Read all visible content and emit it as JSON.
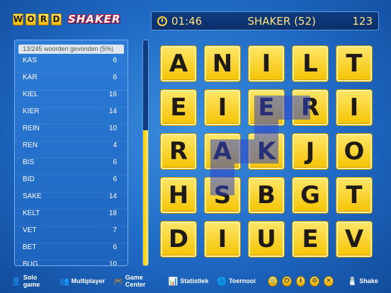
{
  "logo": {
    "tiles": [
      "W",
      "O",
      "R",
      "D"
    ],
    "shaker": "SHAKER"
  },
  "header": {
    "timer": "01:46",
    "mode": "SHAKER (52)",
    "score": "123"
  },
  "panel": {
    "found_text": "13/245 woorden gevonden (5%)",
    "words": [
      {
        "word": "KAS",
        "points": "6"
      },
      {
        "word": "KAR",
        "points": "6"
      },
      {
        "word": "KIEL",
        "points": "16"
      },
      {
        "word": "KIER",
        "points": "14"
      },
      {
        "word": "REIN",
        "points": "10"
      },
      {
        "word": "REN",
        "points": "4"
      },
      {
        "word": "BIS",
        "points": "6"
      },
      {
        "word": "BID",
        "points": "6"
      },
      {
        "word": "SAKE",
        "points": "14"
      },
      {
        "word": "KELT",
        "points": "18"
      },
      {
        "word": "VET",
        "points": "7"
      },
      {
        "word": "BET",
        "points": "6"
      },
      {
        "word": "BUG",
        "points": "10"
      }
    ]
  },
  "progress": {
    "fraction": 0.6
  },
  "grid": [
    [
      "A",
      "N",
      "I",
      "L",
      "T"
    ],
    [
      "E",
      "I",
      "E",
      "R",
      "I"
    ],
    [
      "R",
      "A",
      "K",
      "J",
      "O"
    ],
    [
      "H",
      "S",
      "B",
      "G",
      "T"
    ],
    [
      "D",
      "I",
      "U",
      "E",
      "V"
    ]
  ],
  "trail": {
    "color": "#2f46c8",
    "path": [
      [
        3,
        1
      ],
      [
        2,
        1
      ],
      [
        2,
        2
      ],
      [
        1,
        2
      ],
      [
        1,
        3
      ]
    ]
  },
  "toolbar": {
    "items": [
      {
        "label": "Solo game",
        "icon": "person-icon"
      },
      {
        "label": "Multiplayer",
        "icon": "people-icon"
      },
      {
        "label": "Game Center",
        "icon": "controller-icon"
      },
      {
        "label": "Statistiek",
        "icon": "stats-icon"
      },
      {
        "label": "Toernooi",
        "icon": "globe-icon"
      }
    ],
    "buttons": [
      {
        "icon": "cart-icon",
        "glyph": "🛒"
      },
      {
        "icon": "power-icon",
        "glyph": "⏻"
      },
      {
        "icon": "info-icon",
        "glyph": "i"
      },
      {
        "icon": "gear-icon",
        "glyph": "⚙"
      },
      {
        "icon": "close-icon",
        "glyph": "✕"
      }
    ],
    "shake_label": "Shake"
  }
}
